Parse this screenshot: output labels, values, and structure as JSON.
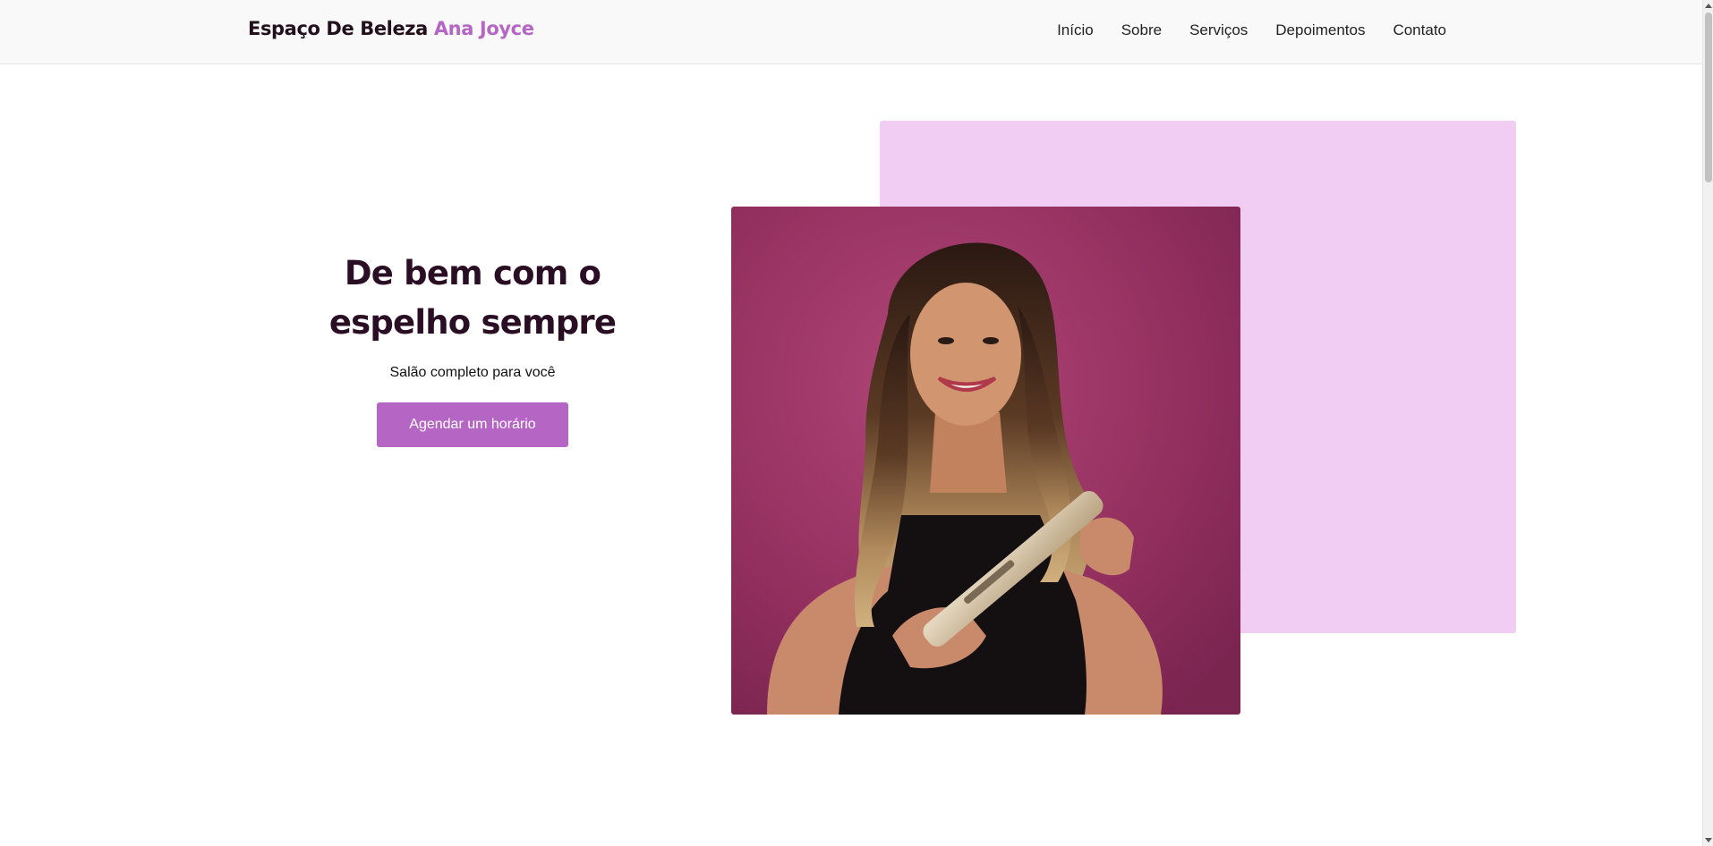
{
  "header": {
    "brand_main": "Espaço De Beleza",
    "brand_accent": "Ana Joyce",
    "nav": [
      {
        "label": "Início"
      },
      {
        "label": "Sobre"
      },
      {
        "label": "Serviços"
      },
      {
        "label": "Depoimentos"
      },
      {
        "label": "Contato"
      }
    ]
  },
  "hero": {
    "title_line1": "De bem com o",
    "title_line2": "espelho sempre",
    "subtitle": "Salão completo para você",
    "cta_label": "Agendar um horário",
    "image_icon": "woman-with-hair-straightener-photo"
  },
  "colors": {
    "accent": "#b566c4",
    "decor_block": "#f1cdf4",
    "heading": "#2a0f24",
    "photo_background": "#9a2f5e"
  }
}
